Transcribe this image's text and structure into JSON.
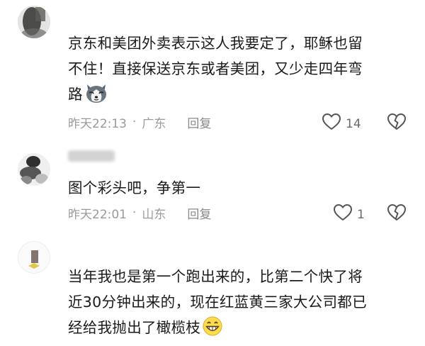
{
  "comments": [
    {
      "text_lines": [
        "京东和美团外卖表示这人我要定了，耶稣也留",
        "不住！直接保送京东或者美团，又少走四年弯",
        "路"
      ],
      "emoji": "husky-dog-emoji",
      "time": "昨天22:13",
      "location": "广东",
      "reply_label": "回复",
      "like_count": "14"
    },
    {
      "text_lines": [
        "图个彩头吧，争第一"
      ],
      "time": "昨天22:01",
      "location": "山东",
      "reply_label": "回复",
      "like_count": "1"
    },
    {
      "text_lines": [
        "当年我也是第一个跑出来的，比第二个快了将",
        "近30分钟出来的，现在红蓝黄三家大公司都已",
        "经给我抛出了橄榄枝"
      ],
      "emoji": "grinning-face-emoji"
    }
  ],
  "separator": "·",
  "colors": {
    "text": "#1a1a1a",
    "meta": "#9a9a9a",
    "icon": "#555555"
  }
}
